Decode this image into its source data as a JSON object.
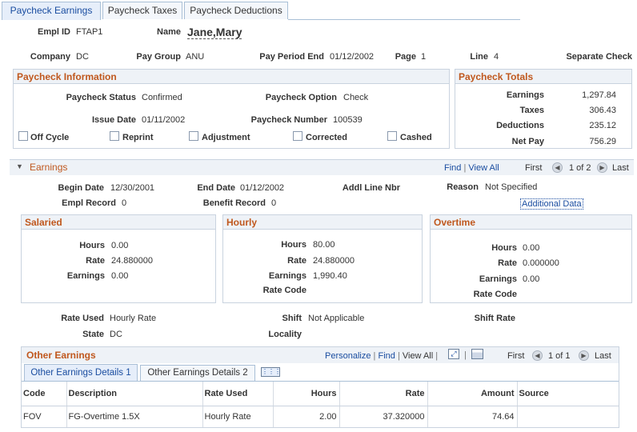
{
  "tabs": [
    {
      "label": "Paycheck Earnings"
    },
    {
      "label": "Paycheck Taxes"
    },
    {
      "label": "Paycheck Deductions"
    }
  ],
  "header": {
    "empl_id_label": "Empl ID",
    "empl_id": "FTAP1",
    "name_label": "Name",
    "name": "Jane,Mary",
    "company_label": "Company",
    "company": "DC",
    "pay_group_label": "Pay Group",
    "pay_group": "ANU",
    "pay_period_end_label": "Pay Period End",
    "pay_period_end": "01/12/2002",
    "page_label": "Page",
    "page": "1",
    "line_label": "Line",
    "line": "4",
    "separate_check": "Separate Check"
  },
  "paycheck_info": {
    "title": "Paycheck Information",
    "status_label": "Paycheck Status",
    "status": "Confirmed",
    "option_label": "Paycheck Option",
    "option": "Check",
    "issue_date_label": "Issue Date",
    "issue_date": "01/11/2002",
    "number_label": "Paycheck Number",
    "number": "100539",
    "checkboxes": [
      "Off Cycle",
      "Reprint",
      "Adjustment",
      "Corrected",
      "Cashed"
    ]
  },
  "paycheck_totals": {
    "title": "Paycheck Totals",
    "rows": [
      {
        "label": "Earnings",
        "value": "1,297.84"
      },
      {
        "label": "Taxes",
        "value": "306.43"
      },
      {
        "label": "Deductions",
        "value": "235.12"
      },
      {
        "label": "Net Pay",
        "value": "756.29"
      }
    ]
  },
  "earnings": {
    "title": "Earnings",
    "find": "Find",
    "view_all": "View All",
    "first": "First",
    "counter": "1 of 2",
    "last": "Last",
    "begin_date_label": "Begin Date",
    "begin_date": "12/30/2001",
    "end_date_label": "End Date",
    "end_date": "01/12/2002",
    "addl_line_label": "Addl Line Nbr",
    "reason_label": "Reason",
    "reason": "Not Specified",
    "empl_record_label": "Empl Record",
    "empl_record": "0",
    "benefit_record_label": "Benefit Record",
    "benefit_record": "0",
    "additional_data": "Additional Data",
    "salaried": {
      "title": "Salaried",
      "hours_label": "Hours",
      "hours": "0.00",
      "rate_label": "Rate",
      "rate": "24.880000",
      "earnings_label": "Earnings",
      "earnings": "0.00"
    },
    "hourly": {
      "title": "Hourly",
      "hours_label": "Hours",
      "hours": "80.00",
      "rate_label": "Rate",
      "rate": "24.880000",
      "earnings_label": "Earnings",
      "earnings": "1,990.40",
      "rate_code_label": "Rate Code"
    },
    "overtime": {
      "title": "Overtime",
      "hours_label": "Hours",
      "hours": "0.00",
      "rate_label": "Rate",
      "rate": "0.000000",
      "earnings_label": "Earnings",
      "earnings": "0.00",
      "rate_code_label": "Rate Code"
    },
    "rate_used_label": "Rate Used",
    "rate_used": "Hourly Rate",
    "shift_label": "Shift",
    "shift": "Not Applicable",
    "shift_rate_label": "Shift Rate",
    "state_label": "State",
    "state": "DC",
    "locality_label": "Locality"
  },
  "other_earnings": {
    "title": "Other Earnings",
    "personalize": "Personalize",
    "find": "Find",
    "view_all": "View All",
    "first": "First",
    "counter": "1 of 1",
    "last": "Last",
    "subtabs": [
      "Other Earnings Details 1",
      "Other Earnings Details 2"
    ],
    "columns": [
      "Code",
      "Description",
      "Rate Used",
      "Hours",
      "Rate",
      "Amount",
      "Source"
    ],
    "rows": [
      {
        "code": "FOV",
        "description": "FG-Overtime 1.5X",
        "rate_used": "Hourly Rate",
        "hours": "2.00",
        "rate": "37.320000",
        "amount": "74.64",
        "source": ""
      }
    ]
  }
}
